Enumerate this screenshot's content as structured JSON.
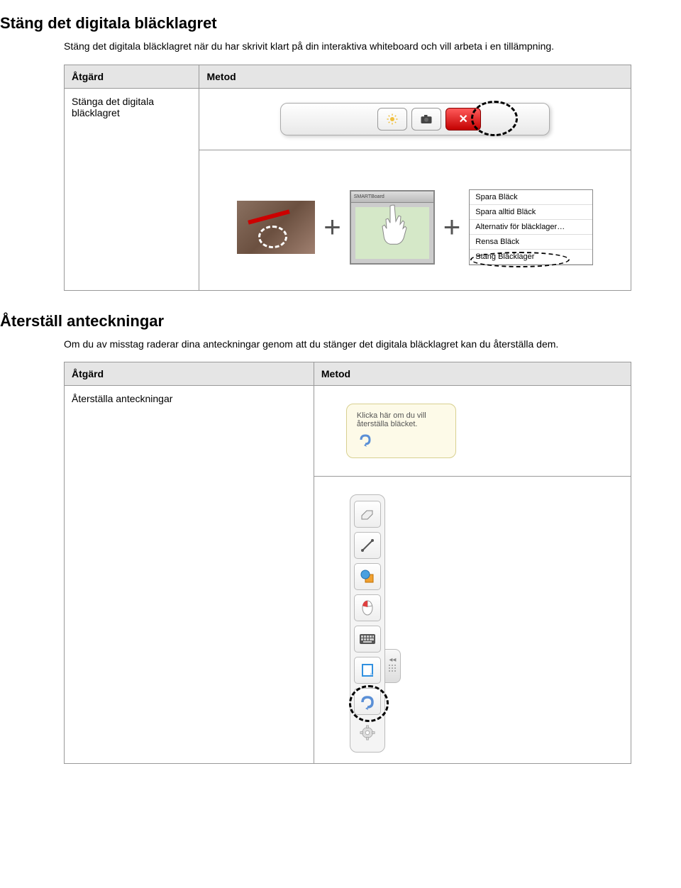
{
  "section1": {
    "title": "Stäng det digitala bläcklagret",
    "body": "Stäng det digitala bläcklagret när du har skrivit klart på din interaktiva whiteboard och vill arbeta i en tillämpning.",
    "table": {
      "head_action": "Åtgärd",
      "head_method": "Metod",
      "action": "Stänga det digitala bläcklagret"
    },
    "toolbar": {
      "brightness_icon": "brightness",
      "camera_icon": "camera",
      "close_icon": "close"
    },
    "touch_panel_brand": "SMARTBoard",
    "menu": {
      "item1": "Spara Bläck",
      "item2": "Spara alltid Bläck",
      "item3": "Alternativ för bläcklager…",
      "item4": "Rensa Bläck",
      "item5": "Stäng Bläcklager"
    }
  },
  "section2": {
    "title": "Återställ anteckningar",
    "body": "Om du av misstag raderar dina anteckningar genom att du stänger det digitala bläcklagret kan du återställa dem.",
    "table": {
      "head_action": "Åtgärd",
      "head_method": "Metod",
      "action": "Återställa anteckningar"
    },
    "tooltip": "Klicka här om du vill återställa bläcket.",
    "vtoolbar": {
      "eraser": "eraser",
      "line": "line",
      "shape": "shape",
      "hide": "hide",
      "keyboard": "keyboard",
      "note": "note",
      "undo": "undo",
      "settings": "settings"
    }
  }
}
